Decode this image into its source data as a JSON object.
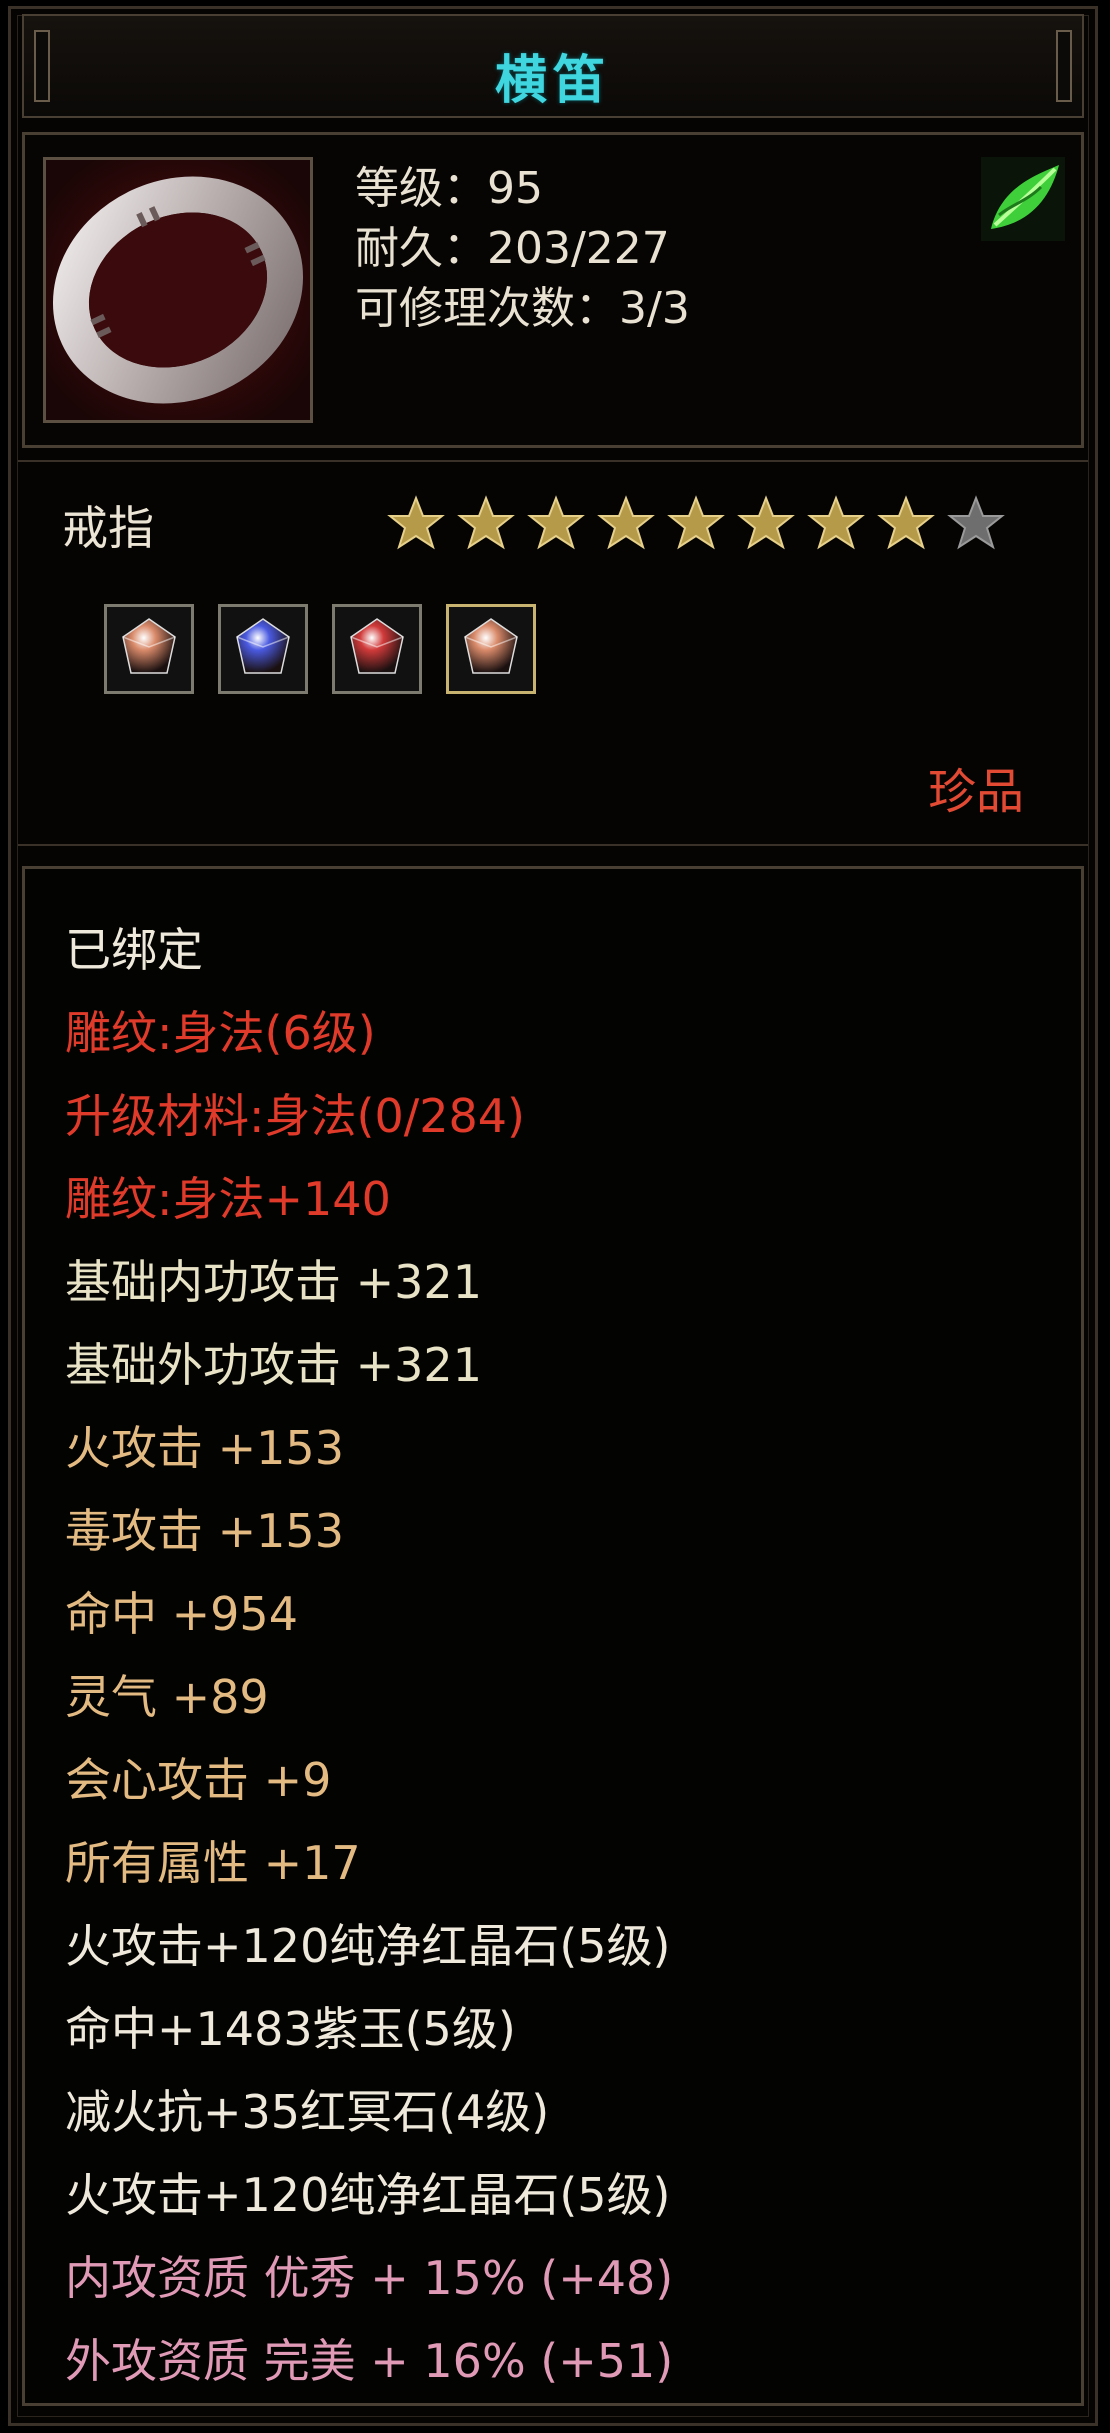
{
  "item": {
    "name": "横笛",
    "level_line": "等级：95",
    "durability_line": "耐久：203/227",
    "repair_line": "可修理次数：3/3",
    "type": "戒指",
    "rarity": "珍品",
    "icon": "ring-icon",
    "badge_icon": "green-leaf-icon",
    "stars": {
      "filled": 8,
      "total": 9
    }
  },
  "gems": [
    {
      "icon": "pink-gem-icon",
      "color": "#d98a6a",
      "frame": "silver"
    },
    {
      "icon": "blue-gem-icon",
      "color": "#4a5ae0",
      "frame": "silver"
    },
    {
      "icon": "red-gem-icon",
      "color": "#d13a3a",
      "frame": "silver"
    },
    {
      "icon": "pink-gem-icon",
      "color": "#d98a6a",
      "frame": "gold"
    }
  ],
  "colors": {
    "title": "#3fd6e0",
    "white": "#efe9dc",
    "red": "#e03a2a",
    "cream": "#e8e3c6",
    "gold": "#e3ba82",
    "pink": "#e09ab6",
    "rarity": "#e24a34"
  },
  "attributes": [
    {
      "text": "已绑定",
      "color": "white"
    },
    {
      "text": "雕纹:身法(6级)",
      "color": "red"
    },
    {
      "text": "升级材料:身法(0/284)",
      "color": "red"
    },
    {
      "text": "雕纹:身法+140",
      "color": "red"
    },
    {
      "text": "基础内功攻击 +321",
      "color": "cream"
    },
    {
      "text": "基础外功攻击 +321",
      "color": "cream"
    },
    {
      "text": "火攻击 +153",
      "color": "gold"
    },
    {
      "text": "毒攻击 +153",
      "color": "gold"
    },
    {
      "text": "命中 +954",
      "color": "gold"
    },
    {
      "text": "灵气 +89",
      "color": "gold"
    },
    {
      "text": "会心攻击 +9",
      "color": "gold"
    },
    {
      "text": "所有属性 +17",
      "color": "gold"
    },
    {
      "text": "火攻击+120纯净红晶石(5级)",
      "color": "white"
    },
    {
      "text": "命中+1483紫玉(5级)",
      "color": "white"
    },
    {
      "text": "减火抗+35红冥石(4级)",
      "color": "white"
    },
    {
      "text": "火攻击+120纯净红晶石(5级)",
      "color": "white"
    },
    {
      "text": "内攻资质 优秀 + 15% (+48)",
      "color": "pink"
    },
    {
      "text": "外攻资质 完美 + 16% (+51)",
      "color": "pink"
    }
  ]
}
